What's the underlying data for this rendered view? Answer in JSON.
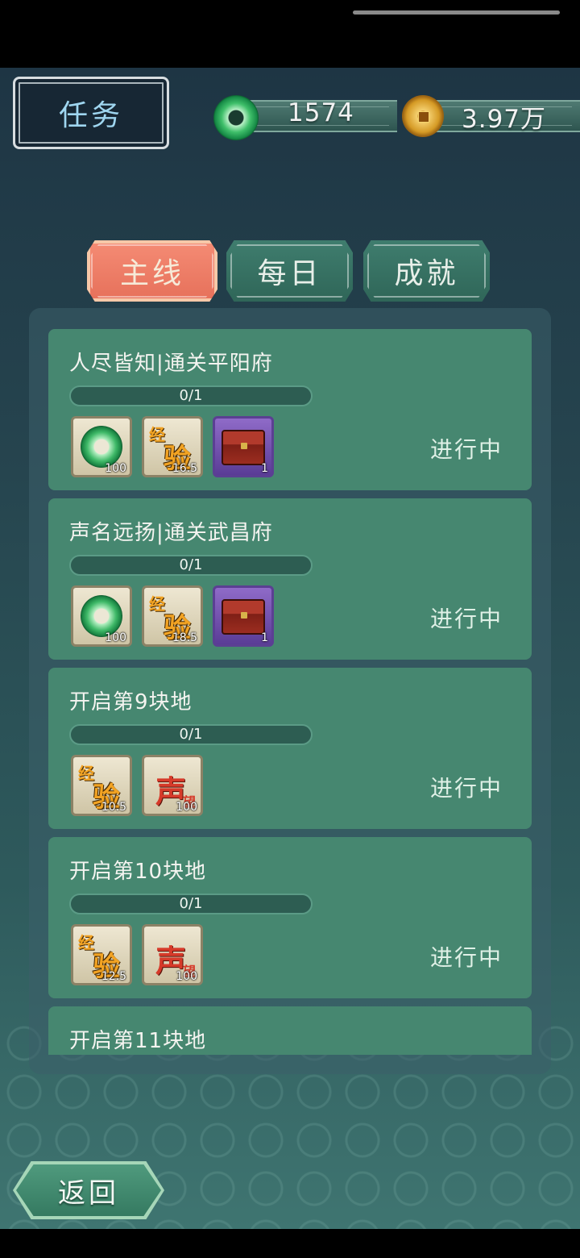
{
  "header": {
    "title": "任务",
    "jade_amount": "1574",
    "coin_amount": "3.97万"
  },
  "tabs": [
    {
      "label": "主线",
      "active": true
    },
    {
      "label": "每日",
      "active": false
    },
    {
      "label": "成就",
      "active": false
    }
  ],
  "tasks": [
    {
      "title": "人尽皆知|通关平阳府",
      "progress": "0/1",
      "progress_fraction": 0,
      "status": "进行中",
      "rewards": [
        {
          "icon": "jade-ring-icon",
          "qty": "100"
        },
        {
          "icon": "experience-icon",
          "qty": "16.5",
          "big": "验",
          "small": "经"
        },
        {
          "icon": "treasure-chest-icon",
          "qty": "1"
        }
      ]
    },
    {
      "title": "声名远扬|通关武昌府",
      "progress": "0/1",
      "progress_fraction": 0,
      "status": "进行中",
      "rewards": [
        {
          "icon": "jade-ring-icon",
          "qty": "100"
        },
        {
          "icon": "experience-icon",
          "qty": "18.5",
          "big": "验",
          "small": "经"
        },
        {
          "icon": "treasure-chest-icon",
          "qty": "1"
        }
      ]
    },
    {
      "title": "开启第9块地",
      "progress": "0/1",
      "progress_fraction": 0,
      "status": "进行中",
      "rewards": [
        {
          "icon": "experience-icon",
          "qty": "10.5",
          "big": "验",
          "small": "经"
        },
        {
          "icon": "reputation-icon",
          "qty": "100",
          "big": "声",
          "small": "望"
        }
      ]
    },
    {
      "title": "开启第10块地",
      "progress": "0/1",
      "progress_fraction": 0,
      "status": "进行中",
      "rewards": [
        {
          "icon": "experience-icon",
          "qty": "12.5",
          "big": "验",
          "small": "经"
        },
        {
          "icon": "reputation-icon",
          "qty": "100",
          "big": "声",
          "small": "望"
        }
      ]
    },
    {
      "title": "开启第11块地"
    }
  ],
  "footer": {
    "back_label": "返回"
  },
  "colors": {
    "active_tab": "#e6705a",
    "inactive_tab": "#3f7d6e",
    "card": "#468770",
    "background_top": "#1e3544",
    "background_bottom": "#3f7571"
  }
}
